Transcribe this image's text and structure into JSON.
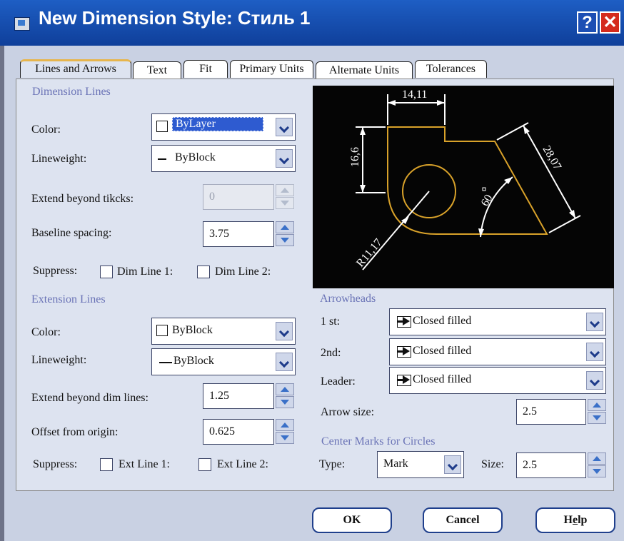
{
  "window": {
    "title": "New Dimension Style: Стиль 1",
    "help_glyph": "?",
    "close_glyph": "✕"
  },
  "tabs": [
    "Lines and Arrows",
    "Text",
    "Fit",
    "Primary Units",
    "Alternate Units",
    "Tolerances"
  ],
  "dimension_lines": {
    "section": "Dimension Lines",
    "color_label": "Color:",
    "color_value": "ByLayer",
    "lineweight_label": "Lineweight:",
    "lineweight_value": "ByBlock",
    "extend_label": "Extend beyond tikcks:",
    "extend_value": "0",
    "baseline_label": "Baseline spacing:",
    "baseline_value": "3.75",
    "suppress_label": "Suppress:",
    "dim_line1": "Dim Line 1:",
    "dim_line2": "Dim Line 2:"
  },
  "extension_lines": {
    "section": "Extension Lines",
    "color_label": "Color:",
    "color_value": "ByBlock",
    "lineweight_label": "Lineweight:",
    "lineweight_value": "ByBlock",
    "extend_label": "Extend beyond dim lines:",
    "extend_value": "1.25",
    "offset_label": "Offset from origin:",
    "offset_value": "0.625",
    "suppress_label": "Suppress:",
    "ext_line1": "Ext Line 1:",
    "ext_line2": "Ext Line 2:"
  },
  "preview": {
    "dim_top": "14,11",
    "dim_left": "16,6",
    "dim_diag": "28,07",
    "angle": "60",
    "radius": "R11,17",
    "line_color": "#d9a22a"
  },
  "arrowheads": {
    "section": "Arrowheads",
    "first_label": "1 st:",
    "first_value": "Closed filled",
    "second_label": "2nd:",
    "second_value": "Closed filled",
    "leader_label": "Leader:",
    "leader_value": "Closed filled",
    "size_label": "Arrow size:",
    "size_value": "2.5"
  },
  "center_marks": {
    "section": "Center Marks for Circles",
    "type_label": "Type:",
    "type_value": "Mark",
    "size_label": "Size:",
    "size_value": "2.5"
  },
  "buttons": {
    "ok": "OK",
    "cancel": "Cancel",
    "help_pre": "H",
    "help_u": "e",
    "help_post": "lp"
  },
  "colors": {
    "title_bar": "#1a55b8",
    "panel": "#dde3f0",
    "section_text": "#6a73b6",
    "close": "#d42a1c"
  }
}
